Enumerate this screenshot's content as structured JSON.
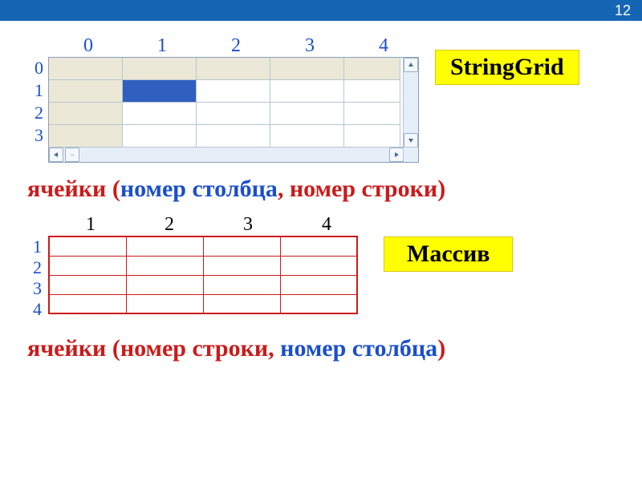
{
  "title_bar": {
    "page_number": "12"
  },
  "stringgrid": {
    "col_headers": [
      "0",
      "1",
      "2",
      "3",
      "4"
    ],
    "row_headers": [
      "0",
      "1",
      "2",
      "3"
    ],
    "label": "StringGrid",
    "selected_cell": {
      "row": 1,
      "col": 1
    }
  },
  "formula1": {
    "word1": "ячейки",
    "open": " (",
    "part1": "номер столбца",
    "comma": ", ",
    "part2": "номер строки",
    "close": ")"
  },
  "array": {
    "col_headers": [
      "1",
      "2",
      "3",
      "4"
    ],
    "row_headers": [
      "1",
      "2",
      "3",
      "4"
    ],
    "label": "Массив"
  },
  "formula2": {
    "word1": "ячейки",
    "open": " (",
    "part1": "номер строки",
    "comma": ", ",
    "part2": "номер столбца",
    "close": ")"
  },
  "colors": {
    "accent_blue": "#1565b5",
    "link_blue": "#1a4fcc",
    "red": "#cc1a1a",
    "yellow": "#ffff00",
    "fixed_bg": "#ece8d8",
    "selection": "#2f5fbf"
  }
}
